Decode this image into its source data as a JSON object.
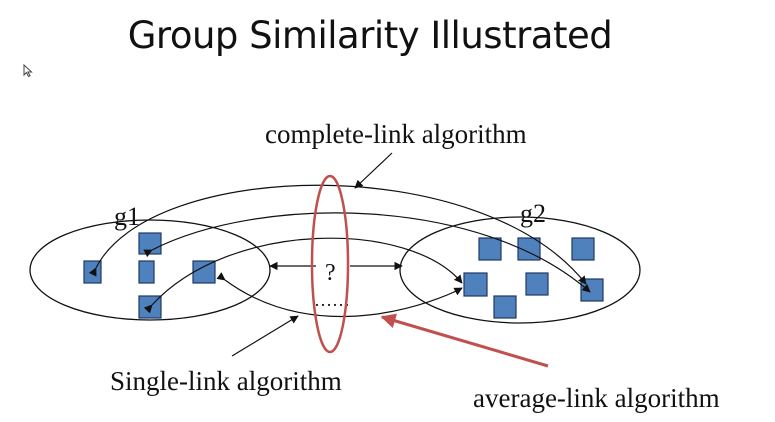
{
  "slide": {
    "title": "Group Similarity Illustrated"
  },
  "diagram": {
    "groups": [
      {
        "label": "g1"
      },
      {
        "label": "g2"
      }
    ],
    "labels": {
      "complete_link": "complete-link algorithm",
      "single_link": "Single-link algorithm",
      "average_link": "average-link algorithm",
      "question": "?",
      "dots": "……"
    },
    "colors": {
      "square_fill": "#4f81bd",
      "square_stroke": "#1f3864",
      "highlight": "#c0504d",
      "line": "#111111"
    }
  }
}
